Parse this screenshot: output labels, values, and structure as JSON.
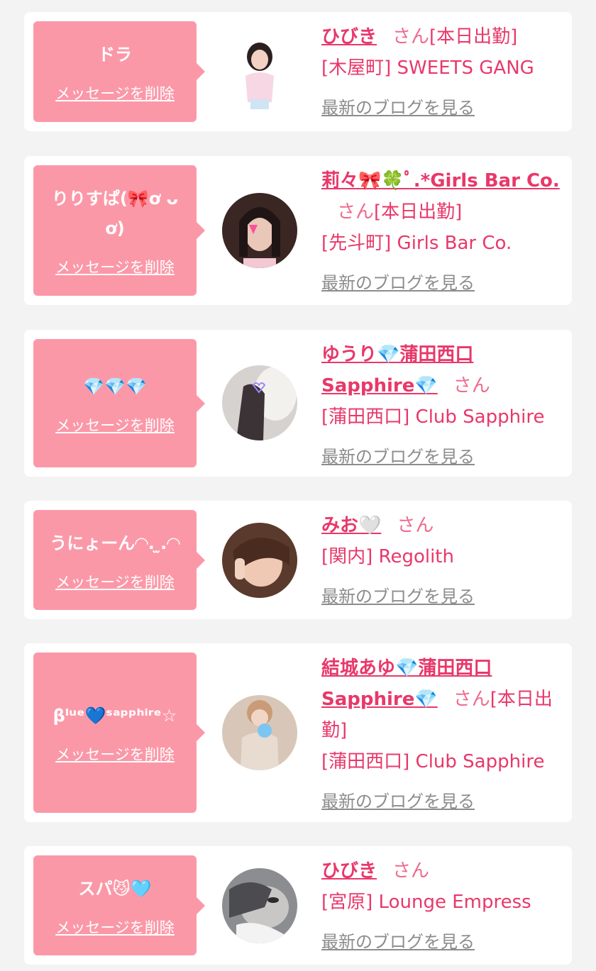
{
  "delete_label": "メッセージを削除",
  "blog_label": "最新のブログを見る",
  "san_label": "さん",
  "colors": {
    "bubble": "#fb98a8",
    "accent": "#e8386a",
    "link_gray": "#8c8c8c",
    "background": "#f3f3f3"
  },
  "cards": [
    {
      "message": "ドラ",
      "name": "ひびき",
      "status": "[本日出勤]",
      "area": "[木屋町] SWEETS GANG",
      "avatar": "cast-photo-icon"
    },
    {
      "message": "りりすぱ(🎀ơ ᴗ ơ)",
      "name": "莉々🎀🍀ﾟ.*Girls Bar Co.",
      "status": "[本日出勤]",
      "area": "[先斗町] Girls Bar Co.",
      "avatar": "cast-photo-icon"
    },
    {
      "message": "💎💎💎",
      "name": "ゆうり💎蒲田西口Sapphire💎",
      "status": "",
      "area": "[蒲田西口] Club Sapphire",
      "avatar": "cast-photo-icon"
    },
    {
      "message": "うにょーん◠.  ̫.◠",
      "name": "みお🤍",
      "status": "",
      "area": "[関内] Regolith",
      "avatar": "cast-photo-icon"
    },
    {
      "message": "βˡᵘᵉ💙ˢᵃᵖᵖʰⁱʳᵉ☆",
      "name": "結城あゆ💎蒲田西口Sapphire💎",
      "status": "[本日出勤]",
      "area": "[蒲田西口] Club Sapphire",
      "avatar": "cast-photo-icon"
    },
    {
      "message": "スパ😼🩵",
      "name": "ひびき",
      "status": "",
      "area": "[宮原] Lounge Empress",
      "avatar": "cast-photo-icon"
    }
  ]
}
